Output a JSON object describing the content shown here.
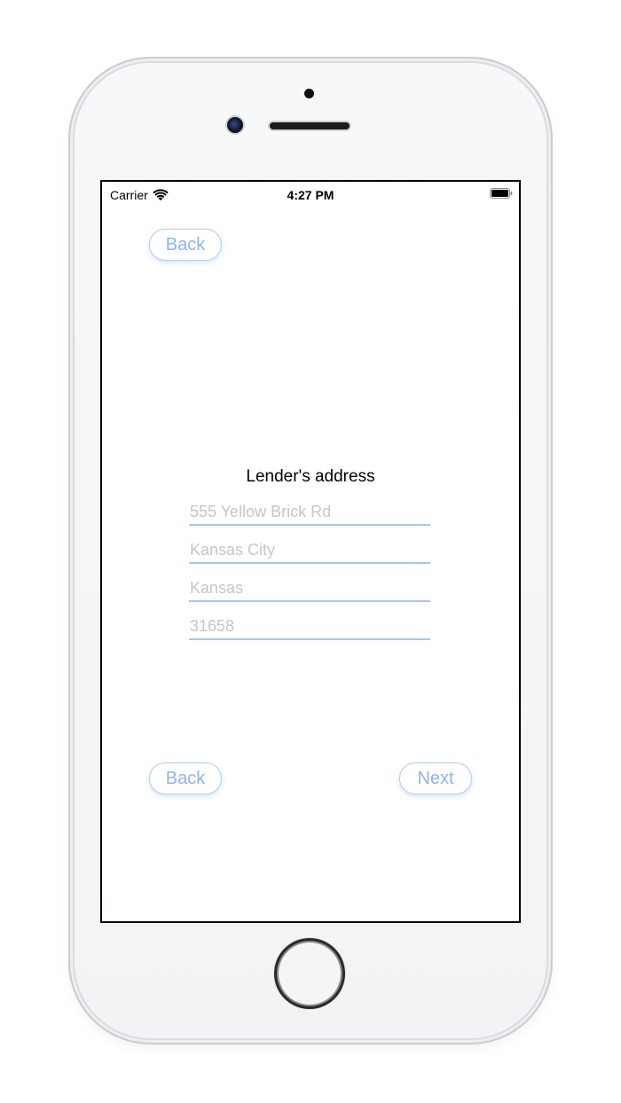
{
  "status_bar": {
    "carrier": "Carrier",
    "time": "4:27 PM",
    "wifi_icon": "wifi-icon",
    "battery_icon": "battery-full-icon"
  },
  "top_back_button": {
    "label": "Back"
  },
  "form": {
    "title": "Lender's address",
    "fields": [
      {
        "name": "street",
        "value": "",
        "placeholder": "555 Yellow Brick Rd"
      },
      {
        "name": "city",
        "value": "",
        "placeholder": "Kansas City"
      },
      {
        "name": "state",
        "value": "",
        "placeholder": "Kansas"
      },
      {
        "name": "zip",
        "value": "",
        "placeholder": "31658"
      }
    ]
  },
  "bottom_nav": {
    "back_label": "Back",
    "next_label": "Next"
  },
  "colors": {
    "accent": "#8fb3ef",
    "field_underline": "#a9c5f3",
    "placeholder": "#c4c6cb"
  }
}
